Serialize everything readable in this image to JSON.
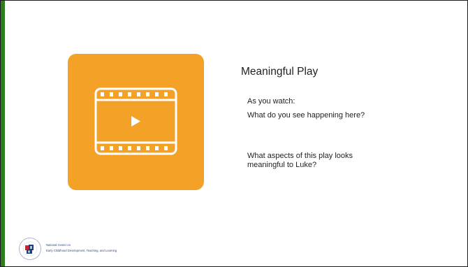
{
  "slide": {
    "title": "Meaningful Play",
    "prompt_intro": "As you watch:",
    "question_1": "What do you see happening here?",
    "question_2": "What aspects of this play looks meaningful to Luke?"
  },
  "logo": {
    "seal_text": "Office of Head Start",
    "line_1": "National Center on",
    "line_2": "Early Childhood Development, Teaching, and Learning"
  },
  "colors": {
    "accent_bar": "#2e7d1f",
    "video_card": "#f4a127",
    "icon": "#ffffff",
    "logo_text": "#2d4d8a"
  },
  "icons": {
    "video": "film-strip-play-icon",
    "seal": "office-of-head-start-seal"
  }
}
